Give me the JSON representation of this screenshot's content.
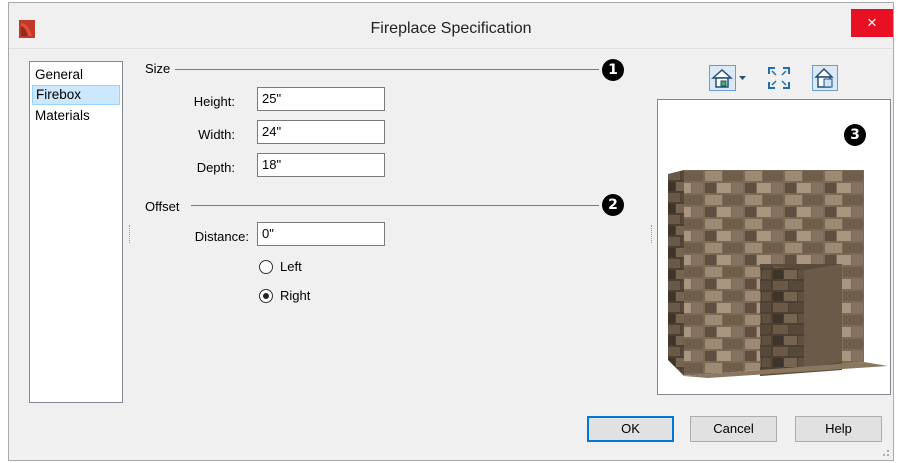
{
  "window": {
    "title": "Fireplace Specification",
    "close_glyph": "×"
  },
  "sidebar": {
    "items": [
      {
        "label": "General",
        "selected": false
      },
      {
        "label": "Firebox",
        "selected": true
      },
      {
        "label": "Materials",
        "selected": false
      }
    ]
  },
  "size_group": {
    "label": "Size",
    "callout": "1",
    "height_label": "Height:",
    "height_value": "25\"",
    "width_label": "Width:",
    "width_value": "24\"",
    "depth_label": "Depth:",
    "depth_value": "18\""
  },
  "offset_group": {
    "label": "Offset",
    "callout": "2",
    "distance_label": "Distance:",
    "distance_value": "0\"",
    "left_label": "Left",
    "left_checked": false,
    "right_label": "Right",
    "right_checked": true
  },
  "preview": {
    "callout": "3",
    "icons": [
      "view-type-icon",
      "fit-view-icon",
      "render-toggle-icon"
    ]
  },
  "buttons": {
    "ok": "OK",
    "cancel": "Cancel",
    "help": "Help"
  },
  "colors": {
    "accent": "#0078d7",
    "close": "#e81123",
    "selection": "#cce8ff"
  }
}
